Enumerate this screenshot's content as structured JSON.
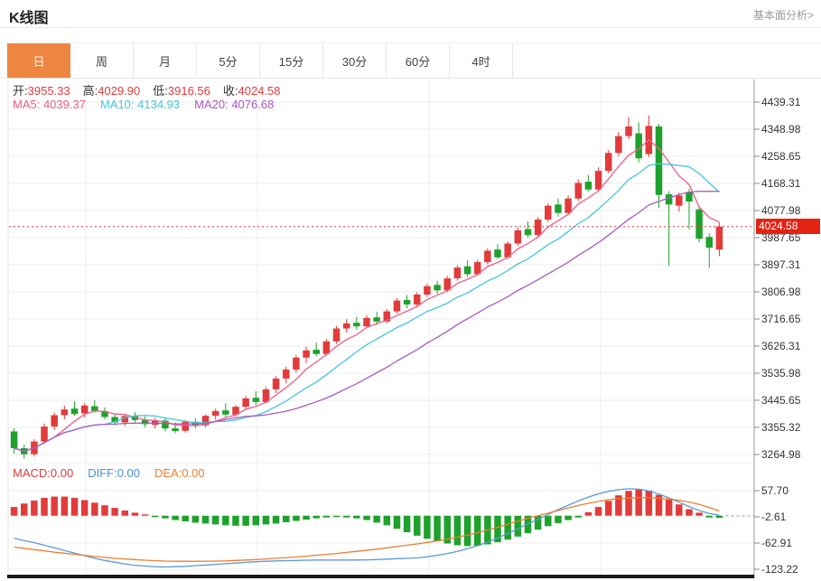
{
  "header": {
    "title": "K线图",
    "link": "基本面分析>"
  },
  "tabs": {
    "items": [
      "日",
      "周",
      "月",
      "5分",
      "15分",
      "30分",
      "60分",
      "4时"
    ],
    "selected_index": 0
  },
  "ohlc": {
    "o_label": "开:",
    "o": "3955.33",
    "h_label": "高:",
    "h": "4029.90",
    "l_label": "低:",
    "l": "3916.56",
    "c_label": "收:",
    "c": "4024.58"
  },
  "ma_legend": {
    "ma5": "MA5: 4039.37",
    "ma10": "MA10: 4134.93",
    "ma20": "MA20: 4076.68"
  },
  "macd_legend": {
    "macd": "MACD:0.00",
    "diff": "DIFF:0.00",
    "dea": "DEA:0.00"
  },
  "price_tag": "4024.58",
  "colors": {
    "up": "#e23b3b",
    "down": "#1ea22c",
    "ma5": "#ee5d88",
    "ma10": "#45c5dc",
    "ma20": "#a75ac0",
    "diff_line": "#5b9bd5",
    "dea_line": "#ed7d31",
    "macd_label": "#e23b3b",
    "diff_label": "#4a90db",
    "dea_label": "#ed7d31",
    "value_red": "#e23b3b",
    "tab_accent": "#ee8540",
    "price_tag_bg": "#e42313",
    "dashed_zero": "#5bc8c0"
  },
  "chart_data": {
    "type": "candlestick+macd",
    "price_axis": {
      "top": 4439.31,
      "step": 90.333,
      "labels": [
        4439.31,
        4348.98,
        4258.65,
        4168.31,
        4077.98,
        3987.65,
        3897.31,
        3806.98,
        3716.65,
        3626.31,
        3535.98,
        3445.65,
        3355.32,
        3264.98
      ]
    },
    "macd_axis": {
      "labels": [
        57.7,
        -2.61,
        -62.91,
        -123.22
      ],
      "step": 60.31
    },
    "current_price": 4024.58,
    "candles": [
      [
        3342,
        3352,
        3268,
        3286
      ],
      [
        3286,
        3298,
        3252,
        3266
      ],
      [
        3266,
        3316,
        3258,
        3308
      ],
      [
        3308,
        3368,
        3300,
        3358
      ],
      [
        3358,
        3405,
        3346,
        3396
      ],
      [
        3396,
        3428,
        3382,
        3415
      ],
      [
        3418,
        3442,
        3394,
        3400
      ],
      [
        3402,
        3436,
        3388,
        3428
      ],
      [
        3426,
        3445,
        3404,
        3410
      ],
      [
        3410,
        3422,
        3382,
        3390
      ],
      [
        3390,
        3402,
        3362,
        3372
      ],
      [
        3372,
        3400,
        3360,
        3393
      ],
      [
        3393,
        3406,
        3372,
        3380
      ],
      [
        3380,
        3392,
        3356,
        3366
      ],
      [
        3364,
        3388,
        3352,
        3378
      ],
      [
        3378,
        3386,
        3342,
        3352
      ],
      [
        3352,
        3372,
        3336,
        3343
      ],
      [
        3344,
        3380,
        3338,
        3374
      ],
      [
        3374,
        3386,
        3352,
        3360
      ],
      [
        3362,
        3398,
        3356,
        3394
      ],
      [
        3394,
        3418,
        3380,
        3410
      ],
      [
        3412,
        3436,
        3388,
        3398
      ],
      [
        3398,
        3430,
        3390,
        3424
      ],
      [
        3424,
        3460,
        3414,
        3452
      ],
      [
        3454,
        3476,
        3430,
        3440
      ],
      [
        3440,
        3490,
        3434,
        3482
      ],
      [
        3482,
        3526,
        3470,
        3518
      ],
      [
        3518,
        3558,
        3502,
        3548
      ],
      [
        3548,
        3596,
        3538,
        3588
      ],
      [
        3588,
        3624,
        3570,
        3612
      ],
      [
        3614,
        3638,
        3592,
        3600
      ],
      [
        3600,
        3650,
        3594,
        3642
      ],
      [
        3642,
        3694,
        3634,
        3685
      ],
      [
        3685,
        3716,
        3672,
        3702
      ],
      [
        3704,
        3724,
        3680,
        3692
      ],
      [
        3692,
        3730,
        3686,
        3720
      ],
      [
        3722,
        3740,
        3696,
        3708
      ],
      [
        3708,
        3750,
        3702,
        3742
      ],
      [
        3742,
        3786,
        3734,
        3778
      ],
      [
        3780,
        3796,
        3752,
        3765
      ],
      [
        3765,
        3806,
        3758,
        3798
      ],
      [
        3798,
        3834,
        3790,
        3826
      ],
      [
        3830,
        3844,
        3800,
        3812
      ],
      [
        3812,
        3860,
        3806,
        3852
      ],
      [
        3852,
        3896,
        3844,
        3888
      ],
      [
        3892,
        3912,
        3858,
        3866
      ],
      [
        3866,
        3914,
        3860,
        3906
      ],
      [
        3906,
        3952,
        3898,
        3944
      ],
      [
        3948,
        3966,
        3916,
        3922
      ],
      [
        3922,
        3976,
        3918,
        3968
      ],
      [
        3968,
        4022,
        3960,
        4012
      ],
      [
        4016,
        4042,
        3988,
        3996
      ],
      [
        3996,
        4056,
        3990,
        4048
      ],
      [
        4048,
        4102,
        4040,
        4094
      ],
      [
        4098,
        4118,
        4058,
        4070
      ],
      [
        4070,
        4128,
        4064,
        4118
      ],
      [
        4118,
        4182,
        4110,
        4170
      ],
      [
        4174,
        4196,
        4142,
        4148
      ],
      [
        4148,
        4222,
        4142,
        4210
      ],
      [
        4210,
        4280,
        4202,
        4270
      ],
      [
        4270,
        4340,
        4258,
        4326
      ],
      [
        4326,
        4390,
        4316,
        4358
      ],
      [
        4335,
        4372,
        4238,
        4252
      ],
      [
        4266,
        4395,
        4256,
        4360
      ],
      [
        4358,
        4366,
        4086,
        4130
      ],
      [
        4132,
        4142,
        3894,
        4098
      ],
      [
        4094,
        4138,
        4075,
        4128
      ],
      [
        4140,
        4150,
        4016,
        4108
      ],
      [
        4082,
        4092,
        3972,
        3984
      ],
      [
        3990,
        4002,
        3888,
        3954
      ],
      [
        3948,
        4038,
        3926,
        4024.58
      ]
    ],
    "ma_periods": [
      5,
      10,
      20
    ],
    "macd": {
      "hist": [
        20,
        28,
        35,
        41,
        44,
        44,
        41,
        36,
        30,
        24,
        18,
        12,
        7,
        3,
        -3,
        -6,
        -10,
        -13,
        -16,
        -18,
        -20,
        -22,
        -23,
        -23,
        -22,
        -20,
        -18,
        -15,
        -12,
        -9,
        -6,
        -4,
        -3,
        -4,
        -6,
        -10,
        -16,
        -22,
        -30,
        -38,
        -46,
        -53,
        -59,
        -64,
        -68,
        -70,
        -69,
        -66,
        -61,
        -55,
        -48,
        -40,
        -32,
        -24,
        -17,
        -10,
        -4,
        8,
        20,
        34,
        47,
        57,
        62,
        58,
        48,
        37,
        26,
        15,
        7,
        -4,
        -5
      ],
      "diff": [
        -52,
        -57,
        -62,
        -68,
        -74,
        -80,
        -86,
        -92,
        -98,
        -103,
        -107,
        -111,
        -114,
        -116,
        -117.5,
        -118,
        -117.5,
        -116.5,
        -115,
        -113.5,
        -112,
        -110.5,
        -109,
        -107.5,
        -106,
        -105,
        -104,
        -103.5,
        -103,
        -102.5,
        -102,
        -102,
        -102,
        -102,
        -102,
        -101.5,
        -101,
        -100,
        -99,
        -98,
        -97,
        -94.5,
        -91,
        -87,
        -82,
        -76,
        -69,
        -61,
        -51,
        -41,
        -30,
        -19,
        -8,
        3,
        14,
        24,
        34,
        43,
        50.5,
        56,
        60,
        62,
        61,
        57,
        50,
        41,
        31,
        21,
        12,
        5,
        1
      ],
      "dea": [
        -72,
        -75,
        -78,
        -81,
        -84,
        -86.5,
        -89,
        -91.5,
        -94,
        -96,
        -98,
        -99.5,
        -101,
        -102.5,
        -103.5,
        -104.5,
        -105,
        -105,
        -105,
        -105,
        -104.5,
        -104,
        -103,
        -102,
        -101,
        -99.5,
        -98,
        -96.5,
        -95,
        -93,
        -91,
        -89,
        -87,
        -84.5,
        -82,
        -79.5,
        -77,
        -74,
        -71,
        -68,
        -65,
        -61.5,
        -58,
        -54,
        -49.5,
        -44.5,
        -39,
        -33,
        -26.5,
        -19.5,
        -12.5,
        -6,
        0,
        6,
        12,
        18,
        23.5,
        28.5,
        33,
        36.5,
        39,
        40.5,
        41.5,
        41.5,
        40.5,
        38.5,
        35.5,
        31.5,
        26,
        19,
        11
      ]
    }
  }
}
